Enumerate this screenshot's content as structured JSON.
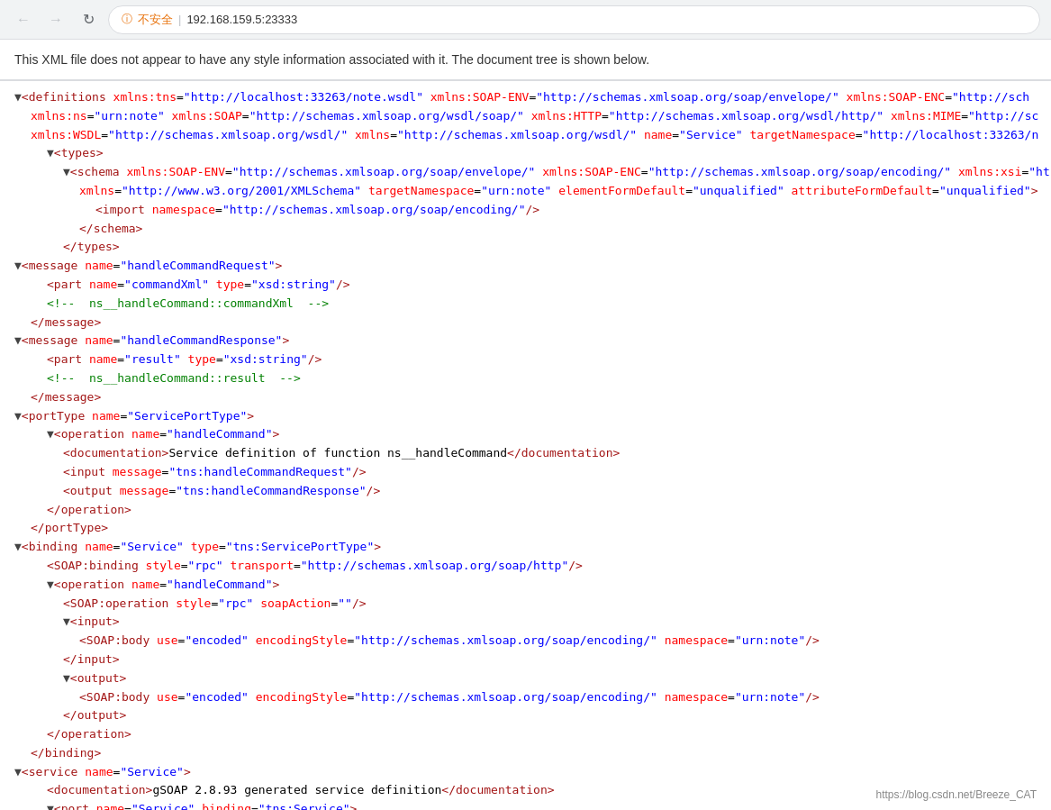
{
  "browser": {
    "back_disabled": true,
    "forward_disabled": true,
    "reload_label": "⟳",
    "security_label": "不安全",
    "separator": "|",
    "url": "192.168.159.5:23333"
  },
  "banner": {
    "text": "This XML file does not appear to have any style information associated with it. The document tree is shown below."
  },
  "footer": {
    "text": "https://blog.csdn.net/Breeze_CAT"
  }
}
